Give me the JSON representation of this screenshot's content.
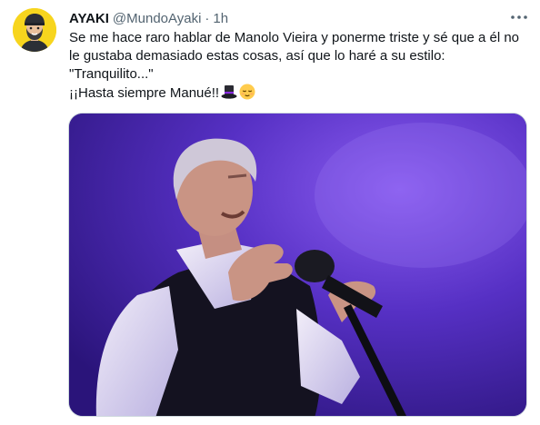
{
  "tweet": {
    "author_name": "AYAKI",
    "handle": "@MundoAyaki",
    "separator": "·",
    "time": "1h",
    "text_lines": [
      "Se me hace raro hablar de Manolo Vieira y ponerme triste y sé que a él no",
      "le gustaba demasiado estas cosas, así que lo haré a su estilo:",
      "\"Tranquilito...\"",
      "¡¡Hasta siempre Manué!!"
    ],
    "emojis": [
      "top-hat-icon",
      "relieved-face-icon"
    ]
  },
  "colors": {
    "text": "#0f1419",
    "secondary": "#536471",
    "avatar_bg": "#f7d51e",
    "photo_bg": "#3a1f93"
  }
}
